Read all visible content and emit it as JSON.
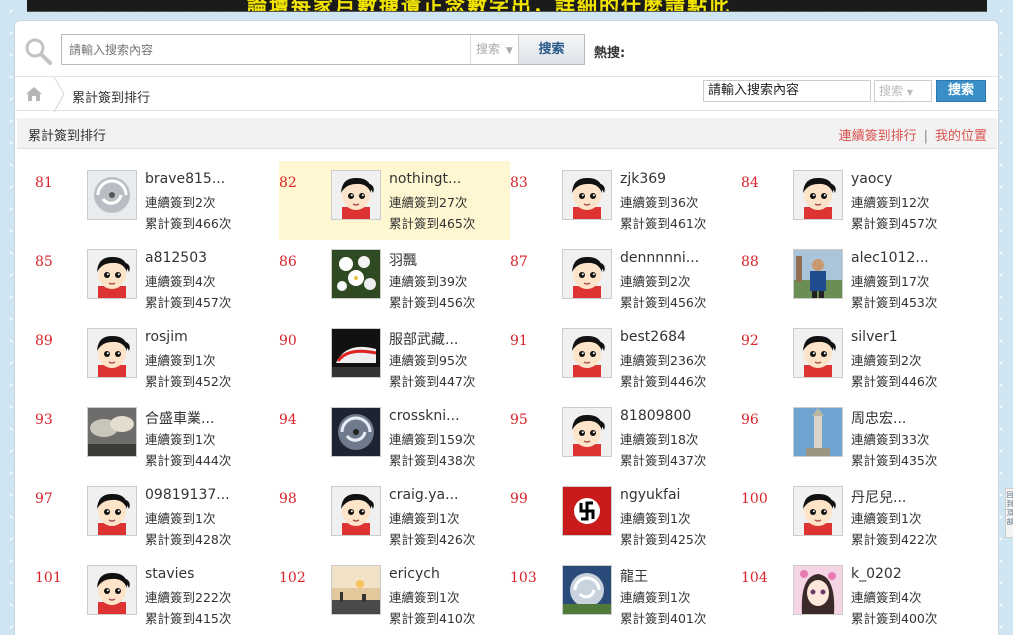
{
  "banner": {
    "text": "論壇每家戶數據遺正念數字出，詳細的什麼請點此"
  },
  "search": {
    "placeholder": "請輸入搜索內容",
    "type_label": "搜索",
    "button": "搜索",
    "hot_label": "熱搜:"
  },
  "breadcrumb": {
    "current": "累計簽到排行"
  },
  "mini_search": {
    "value": "請輸入搜索內容",
    "type_label": "搜索",
    "button": "搜索"
  },
  "section": {
    "title": "累計簽到排行",
    "link_consecutive": "連續簽到排行",
    "separator": "|",
    "link_mine": "我的位置"
  },
  "ranking": [
    {
      "rank": "81",
      "name": "brave815...",
      "streak": "連續簽到2次",
      "total": "累計簽到466次",
      "avatar": "typhoon"
    },
    {
      "rank": "82",
      "name": "nothingt...",
      "streak": "連續簽到27次",
      "total": "累計簽到465次",
      "avatar": "default",
      "highlight": true
    },
    {
      "rank": "83",
      "name": "zjk369",
      "streak": "連續簽到36次",
      "total": "累計簽到461次",
      "avatar": "default"
    },
    {
      "rank": "84",
      "name": "yaocy",
      "streak": "連續簽到12次",
      "total": "累計簽到457次",
      "avatar": "default"
    },
    {
      "rank": "85",
      "name": "a812503",
      "streak": "連續簽到4次",
      "total": "累計簽到457次",
      "avatar": "default"
    },
    {
      "rank": "86",
      "name": "羽飄",
      "streak": "連續簽到39次",
      "total": "累計簽到456次",
      "avatar": "flowers"
    },
    {
      "rank": "87",
      "name": "dennnnni...",
      "streak": "連續簽到2次",
      "total": "累計簽到456次",
      "avatar": "default"
    },
    {
      "rank": "88",
      "name": "alec1012...",
      "streak": "連續簽到17次",
      "total": "累計簽到453次",
      "avatar": "person"
    },
    {
      "rank": "89",
      "name": "rosjim",
      "streak": "連續簽到1次",
      "total": "累計簽到452次",
      "avatar": "default"
    },
    {
      "rank": "90",
      "name": "服部武藏...",
      "streak": "連續簽到95次",
      "total": "累計簽到447次",
      "avatar": "train"
    },
    {
      "rank": "91",
      "name": "best2684",
      "streak": "連續簽到236次",
      "total": "累計簽到446次",
      "avatar": "default"
    },
    {
      "rank": "92",
      "name": "silver1",
      "streak": "連續簽到2次",
      "total": "累計簽到446次",
      "avatar": "default"
    },
    {
      "rank": "93",
      "name": "合盛車業...",
      "streak": "連續簽到1次",
      "total": "累計簽到444次",
      "avatar": "clouds"
    },
    {
      "rank": "94",
      "name": "crosskni...",
      "streak": "連續簽到159次",
      "total": "累計簽到438次",
      "avatar": "typhoon-dark"
    },
    {
      "rank": "95",
      "name": "81809800",
      "streak": "連續簽到18次",
      "total": "累計簽到437次",
      "avatar": "default"
    },
    {
      "rank": "96",
      "name": "周忠宏...",
      "streak": "連續簽到33次",
      "total": "累計簽到435次",
      "avatar": "tower"
    },
    {
      "rank": "97",
      "name": "09819137...",
      "streak": "連續簽到1次",
      "total": "累計簽到428次",
      "avatar": "default"
    },
    {
      "rank": "98",
      "name": "craig.ya...",
      "streak": "連續簽到1次",
      "total": "累計簽到426次",
      "avatar": "default"
    },
    {
      "rank": "99",
      "name": "ngyukfai",
      "streak": "連續簽到1次",
      "total": "累計簽到425次",
      "avatar": "flag"
    },
    {
      "rank": "100",
      "name": "丹尼兒...",
      "streak": "連續簽到1次",
      "total": "累計簽到422次",
      "avatar": "default"
    },
    {
      "rank": "101",
      "name": "stavies",
      "streak": "連續簽到222次",
      "total": "累計簽到415次",
      "avatar": "default"
    },
    {
      "rank": "102",
      "name": "ericych",
      "streak": "連續簽到1次",
      "total": "累計簽到410次",
      "avatar": "sunset"
    },
    {
      "rank": "103",
      "name": "龍王",
      "streak": "連續簽到1次",
      "total": "累計簽到401次",
      "avatar": "satellite"
    },
    {
      "rank": "104",
      "name": "k_0202",
      "streak": "連續簽到4次",
      "total": "累計簽到400次",
      "avatar": "anime"
    }
  ],
  "side_tab": {
    "text": "回到頂部"
  },
  "colors": {
    "rank": "#d9232a",
    "link": "#d9534f",
    "highlight": "#fff7d2",
    "button_blue": "#3b8fc9"
  }
}
